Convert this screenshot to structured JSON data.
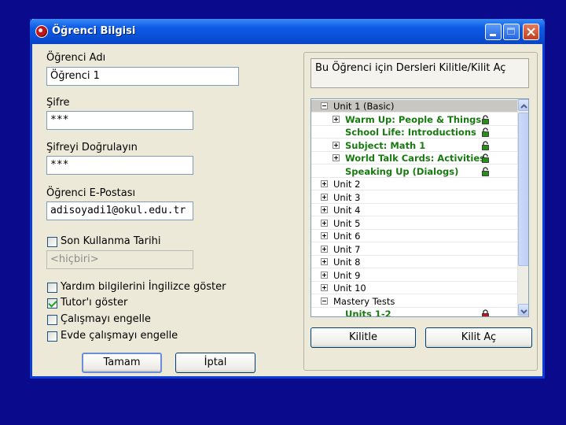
{
  "window": {
    "title": "Öğrenci Bilgisi"
  },
  "form": {
    "name_label": "Öğrenci Adı",
    "name_value": "Öğrenci 1",
    "password_label": "Şifre",
    "password_value": "***",
    "confirm_label": "Şifreyi Doğrulayın",
    "confirm_value": "***",
    "email_label": "Öğrenci E-Postası",
    "email_value": "adisoyadi1@okul.edu.tr",
    "expiry_label": "Son Kullanma Tarihi",
    "expiry_checked": false,
    "expiry_value": "<hiçbiri>",
    "options": [
      {
        "label": "Yardım bilgilerini İngilizce göster",
        "checked": false
      },
      {
        "label": "Tutor'ı göster",
        "checked": true
      },
      {
        "label": "Çalışmayı engelle",
        "checked": false
      },
      {
        "label": "Evde çalışmayı engelle",
        "checked": false
      }
    ],
    "ok_label": "Tamam",
    "cancel_label": "İptal"
  },
  "lessons": {
    "header": "Bu Öğrenci için Dersleri Kilitle/Kilit Aç",
    "tree": [
      {
        "label": "Unit 1 (Basic)",
        "level": 0,
        "expander": "minus",
        "selected": true
      },
      {
        "label": "Warm Up: People & Things",
        "level": 1,
        "expander": "plus",
        "lock": "unlocked"
      },
      {
        "label": "School Life: Introductions",
        "level": 1,
        "expander": "none",
        "lock": "unlocked"
      },
      {
        "label": "Subject: Math 1",
        "level": 1,
        "expander": "plus",
        "lock": "unlocked"
      },
      {
        "label": "World Talk Cards: Activities",
        "level": 1,
        "expander": "plus",
        "lock": "unlocked"
      },
      {
        "label": "Speaking Up (Dialogs)",
        "level": 1,
        "expander": "none",
        "lock": "unlocked"
      },
      {
        "label": "Unit 2",
        "level": 0,
        "expander": "plus"
      },
      {
        "label": "Unit 3",
        "level": 0,
        "expander": "plus"
      },
      {
        "label": "Unit 4",
        "level": 0,
        "expander": "plus"
      },
      {
        "label": "Unit 5",
        "level": 0,
        "expander": "plus"
      },
      {
        "label": "Unit 6",
        "level": 0,
        "expander": "plus"
      },
      {
        "label": "Unit 7",
        "level": 0,
        "expander": "plus"
      },
      {
        "label": "Unit 8",
        "level": 0,
        "expander": "plus"
      },
      {
        "label": "Unit 9",
        "level": 0,
        "expander": "plus"
      },
      {
        "label": "Unit 10",
        "level": 0,
        "expander": "plus"
      },
      {
        "label": "Mastery Tests",
        "level": 0,
        "expander": "minus"
      },
      {
        "label": "Units 1-2",
        "level": 1,
        "expander": "none",
        "lock": "locked"
      }
    ],
    "lock_label": "Kilitle",
    "unlock_label": "Kilit Aç"
  },
  "colors": {
    "lock_unlocked": "#2a8f1a",
    "lock_locked": "#c0151b"
  }
}
